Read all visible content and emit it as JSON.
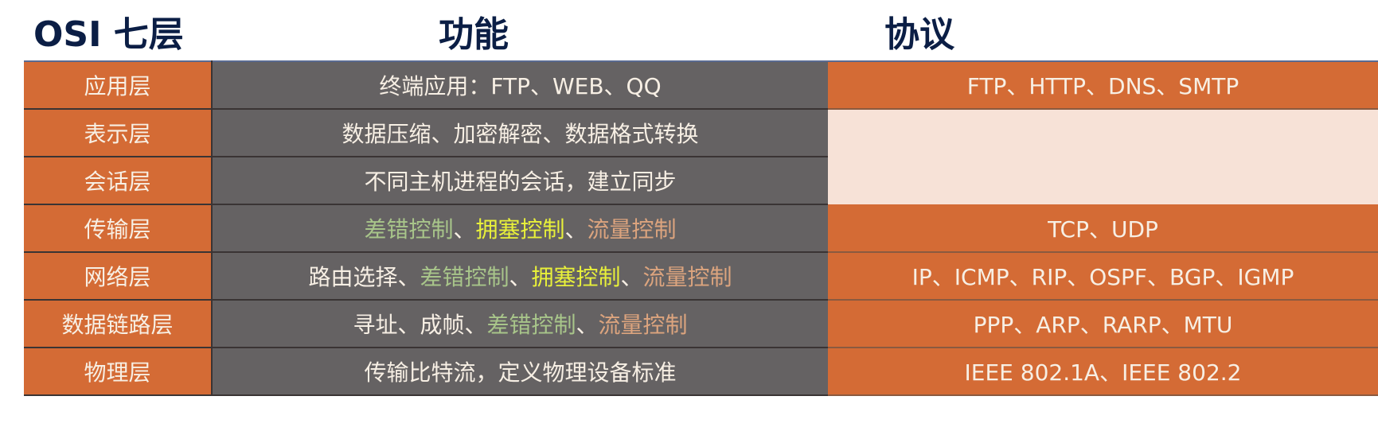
{
  "headers": {
    "layer": "OSI  七层",
    "function": "功能",
    "protocol": "协议"
  },
  "colors": {
    "layer_bg": "#d46b35",
    "function_bg": "#656263",
    "protocol_empty_bg": "#f7e2d7",
    "heading": "#0b1e45",
    "text": "#f7efe4",
    "green": "#a8c58a",
    "yellow": "#e8f03a",
    "tan": "#dca47e"
  },
  "rows": [
    {
      "layer": "应用层",
      "function": [
        {
          "text": "终端应用：FTP、WEB、QQ",
          "color": "text"
        }
      ],
      "protocol": "FTP、HTTP、DNS、SMTP"
    },
    {
      "layer": "表示层",
      "function": [
        {
          "text": "数据压缩、加密解密、数据格式转换",
          "color": "text"
        }
      ],
      "protocol": ""
    },
    {
      "layer": "会话层",
      "function": [
        {
          "text": "不同主机进程的会话，建立同步",
          "color": "text"
        }
      ],
      "protocol": ""
    },
    {
      "layer": "传输层",
      "function": [
        {
          "text": "差错控制",
          "color": "green"
        },
        {
          "text": "、",
          "color": "text"
        },
        {
          "text": "拥塞控制",
          "color": "yellow"
        },
        {
          "text": "、",
          "color": "text"
        },
        {
          "text": "流量控制",
          "color": "tan"
        }
      ],
      "protocol": "TCP、UDP"
    },
    {
      "layer": "网络层",
      "function": [
        {
          "text": "路由选择、",
          "color": "text"
        },
        {
          "text": "差错控制",
          "color": "green"
        },
        {
          "text": "、",
          "color": "text"
        },
        {
          "text": "拥塞控制",
          "color": "yellow"
        },
        {
          "text": "、",
          "color": "text"
        },
        {
          "text": "流量控制",
          "color": "tan"
        }
      ],
      "protocol": "IP、ICMP、RIP、OSPF、BGP、IGMP"
    },
    {
      "layer": "数据链路层",
      "function": [
        {
          "text": "寻址、成帧、",
          "color": "text"
        },
        {
          "text": "差错控制",
          "color": "green"
        },
        {
          "text": "、",
          "color": "text"
        },
        {
          "text": "流量控制",
          "color": "tan"
        }
      ],
      "protocol": "PPP、ARP、RARP、MTU"
    },
    {
      "layer": "物理层",
      "function": [
        {
          "text": "传输比特流，定义物理设备标准",
          "color": "text"
        }
      ],
      "protocol": "IEEE 802.1A、IEEE 802.2"
    }
  ]
}
